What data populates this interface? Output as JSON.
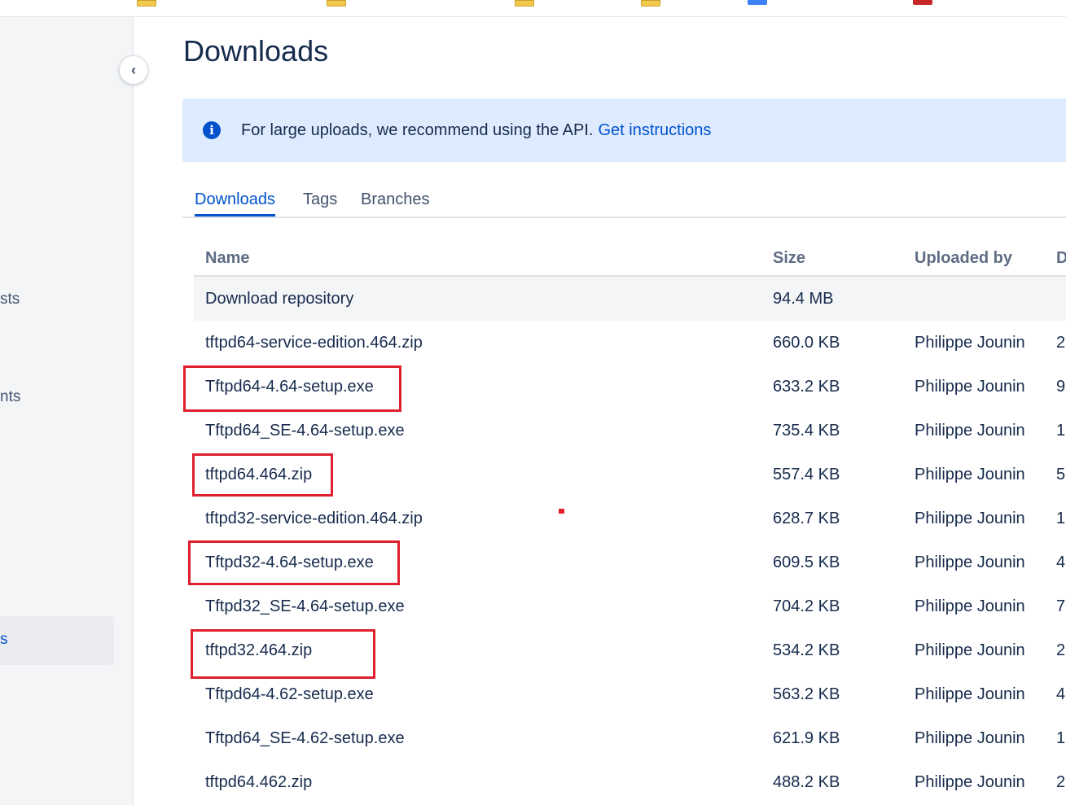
{
  "sidebar": {
    "items": [
      {
        "label": "sts"
      },
      {
        "label": "nts"
      },
      {
        "label": "s"
      }
    ]
  },
  "page": {
    "title": "Downloads"
  },
  "banner": {
    "message": "For large uploads, we recommend using the API.",
    "link": "Get instructions"
  },
  "tabs": [
    {
      "label": "Downloads",
      "active": true
    },
    {
      "label": "Tags",
      "active": false
    },
    {
      "label": "Branches",
      "active": false
    }
  ],
  "table": {
    "headers": {
      "name": "Name",
      "size": "Size",
      "uploaded_by": "Uploaded by",
      "date": "D"
    },
    "rows": [
      {
        "name": "Download repository",
        "size": "94.4 MB",
        "uploaded_by": "",
        "date": ""
      },
      {
        "name": "tftpd64-service-edition.464.zip",
        "size": "660.0 KB",
        "uploaded_by": "Philippe Jounin",
        "date": "2"
      },
      {
        "name": "Tftpd64-4.64-setup.exe",
        "size": "633.2 KB",
        "uploaded_by": "Philippe Jounin",
        "date": "9"
      },
      {
        "name": "Tftpd64_SE-4.64-setup.exe",
        "size": "735.4 KB",
        "uploaded_by": "Philippe Jounin",
        "date": "1"
      },
      {
        "name": "tftpd64.464.zip",
        "size": "557.4 KB",
        "uploaded_by": "Philippe Jounin",
        "date": "5"
      },
      {
        "name": "tftpd32-service-edition.464.zip",
        "size": "628.7 KB",
        "uploaded_by": "Philippe Jounin",
        "date": "1"
      },
      {
        "name": "Tftpd32-4.64-setup.exe",
        "size": "609.5 KB",
        "uploaded_by": "Philippe Jounin",
        "date": "4"
      },
      {
        "name": "Tftpd32_SE-4.64-setup.exe",
        "size": "704.2 KB",
        "uploaded_by": "Philippe Jounin",
        "date": "7"
      },
      {
        "name": "tftpd32.464.zip",
        "size": "534.2 KB",
        "uploaded_by": "Philippe Jounin",
        "date": "2"
      },
      {
        "name": "Tftpd64-4.62-setup.exe",
        "size": "563.2 KB",
        "uploaded_by": "Philippe Jounin",
        "date": "4"
      },
      {
        "name": "Tftpd64_SE-4.62-setup.exe",
        "size": "621.9 KB",
        "uploaded_by": "Philippe Jounin",
        "date": "1"
      },
      {
        "name": "tftpd64.462.zip",
        "size": "488.2 KB",
        "uploaded_by": "Philippe Jounin",
        "date": "2"
      }
    ]
  },
  "colors": {
    "accent": "#0052cc",
    "annotation_red": "#e0202f",
    "banner_bg": "#deebff"
  }
}
